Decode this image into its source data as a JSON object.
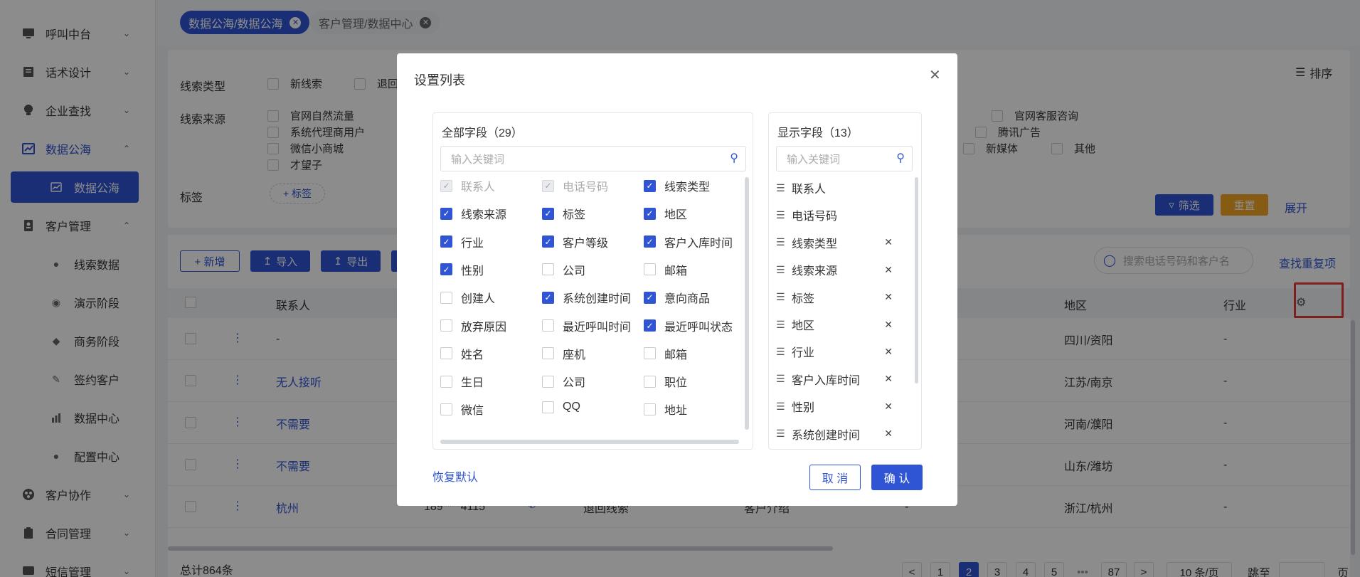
{
  "sidebar": {
    "items": [
      {
        "label": "呼叫中台",
        "icon": "monitor-icon"
      },
      {
        "label": "话术设计",
        "icon": "script-icon"
      },
      {
        "label": "企业查找",
        "icon": "bulb-icon"
      },
      {
        "label": "数据公海",
        "icon": "chart-icon"
      },
      {
        "label": "客户管理",
        "icon": "contacts-icon"
      },
      {
        "label": "客户协作",
        "icon": "collab-icon"
      },
      {
        "label": "合同管理",
        "icon": "clipboard-icon"
      },
      {
        "label": "短信管理",
        "icon": "sms-icon"
      }
    ],
    "sub_data": "数据公海",
    "sub_customer": [
      "线索数据",
      "演示阶段",
      "商务阶段",
      "签约客户",
      "数据中心",
      "配置中心"
    ]
  },
  "tabs": [
    {
      "label": "数据公海/数据公海",
      "active": true
    },
    {
      "label": "客户管理/数据中心",
      "active": false
    }
  ],
  "filter": {
    "type_label": "线索类型",
    "type_options": [
      "新线索",
      "退回"
    ],
    "source_label": "线索来源",
    "source_options_left": [
      "官网自然流量",
      "系统代理商用户",
      "微信小商城",
      "才望子"
    ],
    "source_options_right": [
      "官网客服咨询",
      "腾讯广告",
      "新媒体",
      "其他"
    ],
    "tag_label": "标签",
    "tag_button": "+ 标签",
    "sort_label": "排序",
    "filter_button": "筛选",
    "reset_button": "重置",
    "expand_button": "展开"
  },
  "toolbar": {
    "add": "+ 新增",
    "import": "导入",
    "export": "导出",
    "search_placeholder": "搜索电话号码和客户名",
    "find_dup": "查找重复项"
  },
  "table": {
    "headers": {
      "contact": "联系人",
      "region": "地区",
      "industry": "行业"
    },
    "rows": [
      {
        "contact": "-",
        "region": "四川/资阳",
        "industry": "-"
      },
      {
        "contact": "无人接听",
        "region": "江苏/南京",
        "industry": "-"
      },
      {
        "contact": "不需要",
        "region": "河南/濮阳",
        "industry": "-"
      },
      {
        "contact": "不需要",
        "region": "山东/潍坊",
        "industry": "-"
      },
      {
        "contact": "杭州",
        "phone": "189****4115",
        "status": "退回线索",
        "product": "客户介绍",
        "col5": "-",
        "region": "浙江/杭州",
        "industry": "-"
      }
    ]
  },
  "footer": {
    "total": "总计864条",
    "pages": [
      "1",
      "2",
      "3",
      "4",
      "5",
      "•••",
      "87"
    ],
    "current_page": "2",
    "page_size": "10 条/页",
    "jump": "跳至",
    "page_unit": "页"
  },
  "modal": {
    "title": "设置列表",
    "all_fields_title": "全部字段（29）",
    "all_fields_search": "输入关键词",
    "fields": [
      {
        "label": "联系人",
        "checked": true,
        "disabled": true
      },
      {
        "label": "电话号码",
        "checked": true,
        "disabled": true
      },
      {
        "label": "线索类型",
        "checked": true
      },
      {
        "label": "线索来源",
        "checked": true
      },
      {
        "label": "标签",
        "checked": true
      },
      {
        "label": "地区",
        "checked": true
      },
      {
        "label": "行业",
        "checked": true
      },
      {
        "label": "客户等级",
        "checked": true
      },
      {
        "label": "客户入库时间",
        "checked": true
      },
      {
        "label": "性别",
        "checked": true
      },
      {
        "label": "公司",
        "checked": false
      },
      {
        "label": "邮箱",
        "checked": false
      },
      {
        "label": "创建人",
        "checked": false
      },
      {
        "label": "系统创建时间",
        "checked": true
      },
      {
        "label": "意向商品",
        "checked": true
      },
      {
        "label": "放弃原因",
        "checked": false
      },
      {
        "label": "最近呼叫时间",
        "checked": false
      },
      {
        "label": "最近呼叫状态",
        "checked": true
      },
      {
        "label": "姓名",
        "checked": false
      },
      {
        "label": "座机",
        "checked": false
      },
      {
        "label": "邮箱",
        "checked": false
      },
      {
        "label": "生日",
        "checked": false
      },
      {
        "label": "公司",
        "checked": false
      },
      {
        "label": "职位",
        "checked": false
      },
      {
        "label": "微信",
        "checked": false
      },
      {
        "label": "QQ",
        "checked": false
      },
      {
        "label": "地址",
        "checked": false
      }
    ],
    "shown_fields_title": "显示字段（13）",
    "shown_fields_search": "输入关键词",
    "shown_fields": [
      {
        "label": "联系人",
        "removable": false
      },
      {
        "label": "电话号码",
        "removable": false
      },
      {
        "label": "线索类型",
        "removable": true
      },
      {
        "label": "线索来源",
        "removable": true
      },
      {
        "label": "标签",
        "removable": true
      },
      {
        "label": "地区",
        "removable": true
      },
      {
        "label": "行业",
        "removable": true
      },
      {
        "label": "客户入库时间",
        "removable": true
      },
      {
        "label": "性别",
        "removable": true
      },
      {
        "label": "系统创建时间",
        "removable": true
      }
    ],
    "restore": "恢复默认",
    "cancel": "取 消",
    "confirm": "确 认"
  },
  "colors": {
    "primary": "#2f55d4",
    "reset": "#f5a623",
    "highlight": "#e53935"
  }
}
